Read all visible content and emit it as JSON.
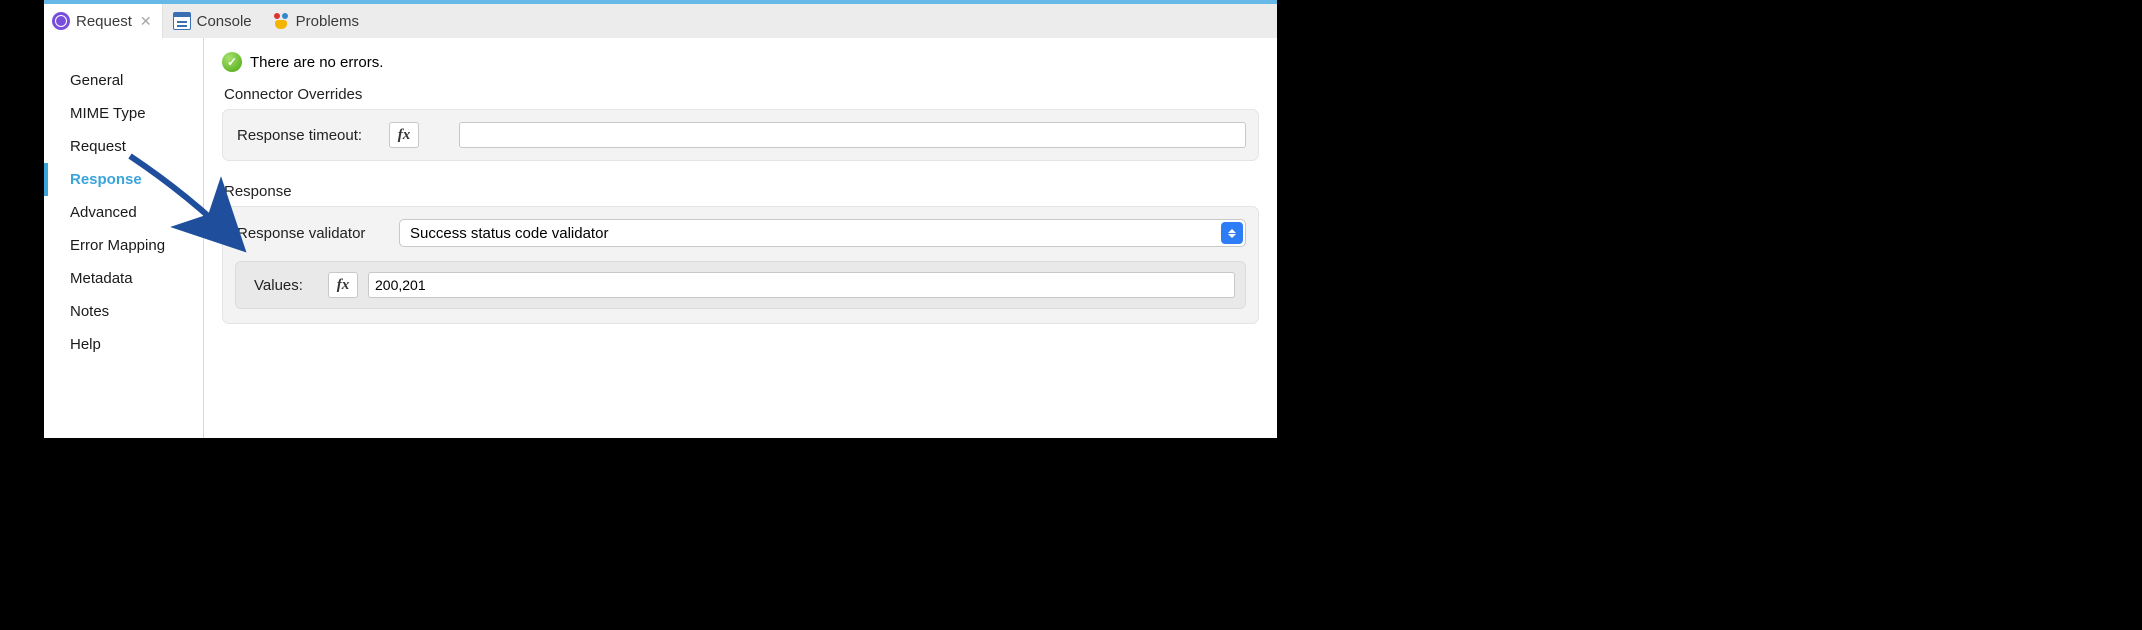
{
  "tabs": [
    {
      "label": "Request",
      "active": true
    },
    {
      "label": "Console",
      "active": false
    },
    {
      "label": "Problems",
      "active": false
    }
  ],
  "sidebar": {
    "items": [
      {
        "label": "General"
      },
      {
        "label": "MIME Type"
      },
      {
        "label": "Request"
      },
      {
        "label": "Response",
        "active": true
      },
      {
        "label": "Advanced"
      },
      {
        "label": "Error Mapping"
      },
      {
        "label": "Metadata"
      },
      {
        "label": "Notes"
      },
      {
        "label": "Help"
      }
    ]
  },
  "status": {
    "message": "There are no errors."
  },
  "sections": {
    "overrides": {
      "title": "Connector Overrides",
      "timeout_label": "Response timeout:",
      "fx_label": "fx",
      "timeout_value": ""
    },
    "response": {
      "title": "Response",
      "validator_label": "Response validator",
      "validator_selected": "Success status code validator",
      "values_label": "Values:",
      "fx_label": "fx",
      "values_value": "200,201"
    }
  }
}
